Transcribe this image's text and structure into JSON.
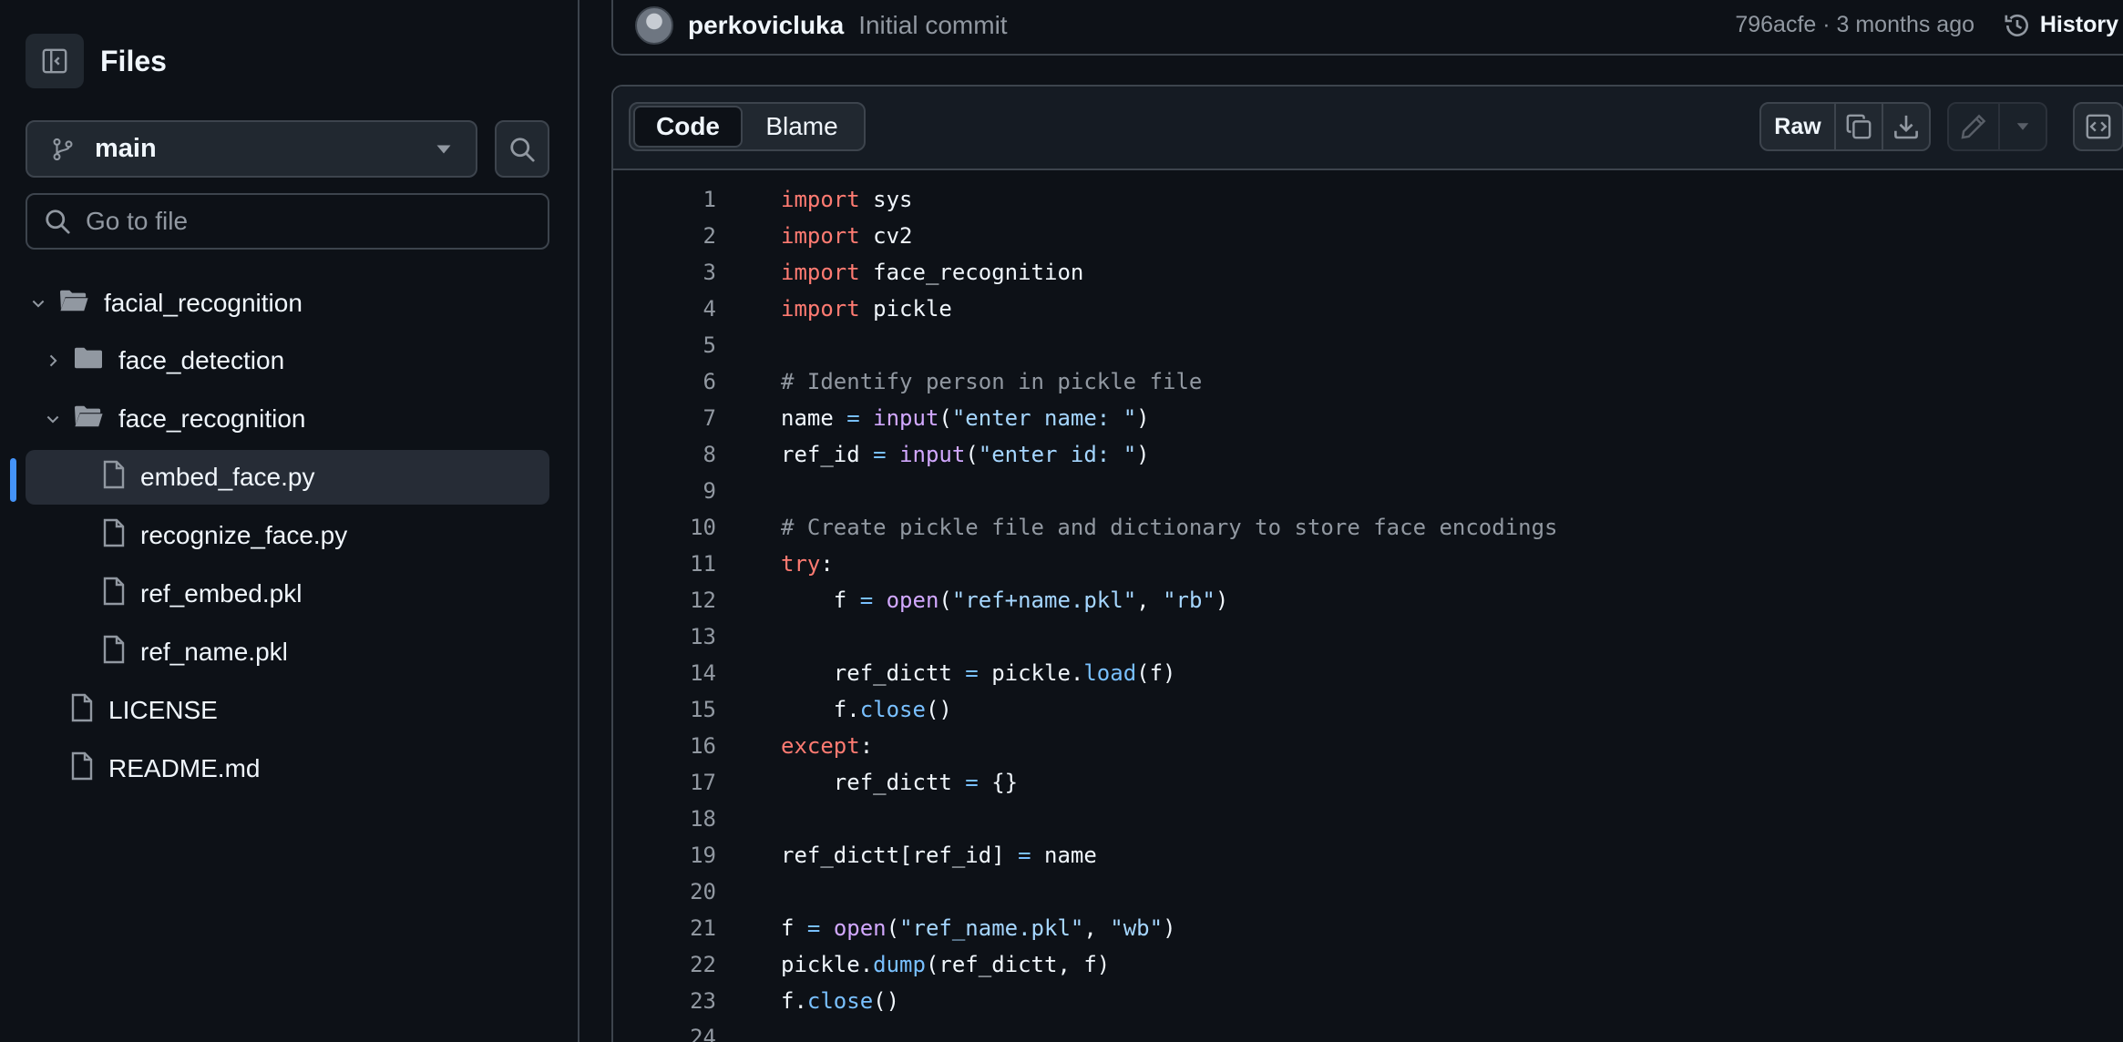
{
  "sidebar": {
    "title": "Files",
    "branch": "main",
    "goto_placeholder": "Go to file",
    "tree": [
      {
        "label": "facial_recognition",
        "type": "folder",
        "depth": 0,
        "expanded": true
      },
      {
        "label": "face_detection",
        "type": "folder",
        "depth": 1,
        "expanded": false
      },
      {
        "label": "face_recognition",
        "type": "folder",
        "depth": 1,
        "expanded": true
      },
      {
        "label": "embed_face.py",
        "type": "file",
        "depth": 2,
        "selected": true
      },
      {
        "label": "recognize_face.py",
        "type": "file",
        "depth": 2
      },
      {
        "label": "ref_embed.pkl",
        "type": "file",
        "depth": 2
      },
      {
        "label": "ref_name.pkl",
        "type": "file",
        "depth": 2
      },
      {
        "label": "LICENSE",
        "type": "file",
        "depth": 0
      },
      {
        "label": "README.md",
        "type": "file",
        "depth": 0
      }
    ]
  },
  "commit": {
    "author": "perkovicluka",
    "message": "Initial commit",
    "meta": "796acfe · 3 months ago",
    "history_label": "History"
  },
  "file_header": {
    "tab_code": "Code",
    "tab_blame": "Blame",
    "raw_label": "Raw",
    "icons": [
      "copy-icon",
      "download-icon",
      "pencil-icon",
      "triangle-down-icon",
      "code-square-icon"
    ]
  },
  "code": {
    "lines": [
      [
        [
          "kw",
          "import"
        ],
        [
          "id",
          " sys"
        ]
      ],
      [
        [
          "kw",
          "import"
        ],
        [
          "id",
          " cv2"
        ]
      ],
      [
        [
          "kw",
          "import"
        ],
        [
          "id",
          " face_recognition"
        ]
      ],
      [
        [
          "kw",
          "import"
        ],
        [
          "id",
          " pickle"
        ]
      ],
      [],
      [
        [
          "cm",
          "# Identify person in pickle file"
        ]
      ],
      [
        [
          "id",
          "name "
        ],
        [
          "op",
          "="
        ],
        [
          "id",
          " "
        ],
        [
          "fn",
          "input"
        ],
        [
          "id",
          "("
        ],
        [
          "str",
          "\"enter name: \""
        ],
        [
          "id",
          ")"
        ]
      ],
      [
        [
          "id",
          "ref_id "
        ],
        [
          "op",
          "="
        ],
        [
          "id",
          " "
        ],
        [
          "fn",
          "input"
        ],
        [
          "id",
          "("
        ],
        [
          "str",
          "\"enter id: \""
        ],
        [
          "id",
          ")"
        ]
      ],
      [],
      [
        [
          "cm",
          "# Create pickle file and dictionary to store face encodings"
        ]
      ],
      [
        [
          "kw",
          "try"
        ],
        [
          "id",
          ":"
        ]
      ],
      [
        [
          "id",
          "    f "
        ],
        [
          "op",
          "="
        ],
        [
          "id",
          " "
        ],
        [
          "fn",
          "open"
        ],
        [
          "id",
          "("
        ],
        [
          "str",
          "\"ref+name.pkl\""
        ],
        [
          "id",
          ", "
        ],
        [
          "str",
          "\"rb\""
        ],
        [
          "id",
          ")"
        ]
      ],
      [],
      [
        [
          "id",
          "    ref_dictt "
        ],
        [
          "op",
          "="
        ],
        [
          "id",
          " pickle."
        ],
        [
          "op",
          "load"
        ],
        [
          "id",
          "(f)"
        ]
      ],
      [
        [
          "id",
          "    f."
        ],
        [
          "op",
          "close"
        ],
        [
          "id",
          "()"
        ]
      ],
      [
        [
          "kw",
          "except"
        ],
        [
          "id",
          ":"
        ]
      ],
      [
        [
          "id",
          "    ref_dictt "
        ],
        [
          "op",
          "="
        ],
        [
          "id",
          " {}"
        ]
      ],
      [],
      [
        [
          "id",
          "ref_dictt[ref_id] "
        ],
        [
          "op",
          "="
        ],
        [
          "id",
          " name"
        ]
      ],
      [],
      [
        [
          "id",
          "f "
        ],
        [
          "op",
          "="
        ],
        [
          "id",
          " "
        ],
        [
          "fn",
          "open"
        ],
        [
          "id",
          "("
        ],
        [
          "str",
          "\"ref_name.pkl\""
        ],
        [
          "id",
          ", "
        ],
        [
          "str",
          "\"wb\""
        ],
        [
          "id",
          ")"
        ]
      ],
      [
        [
          "id",
          "pickle."
        ],
        [
          "op",
          "dump"
        ],
        [
          "id",
          "(ref_dictt, f)"
        ]
      ],
      [
        [
          "id",
          "f."
        ],
        [
          "op",
          "close"
        ],
        [
          "id",
          "()"
        ]
      ],
      []
    ]
  },
  "colors": {
    "background": "#0d1117",
    "border": "#3d444d",
    "accent": "#4493f8",
    "keyword": "#ff7b72",
    "string": "#a5d6ff",
    "function": "#d2a8ff",
    "comment": "#9198a1"
  }
}
